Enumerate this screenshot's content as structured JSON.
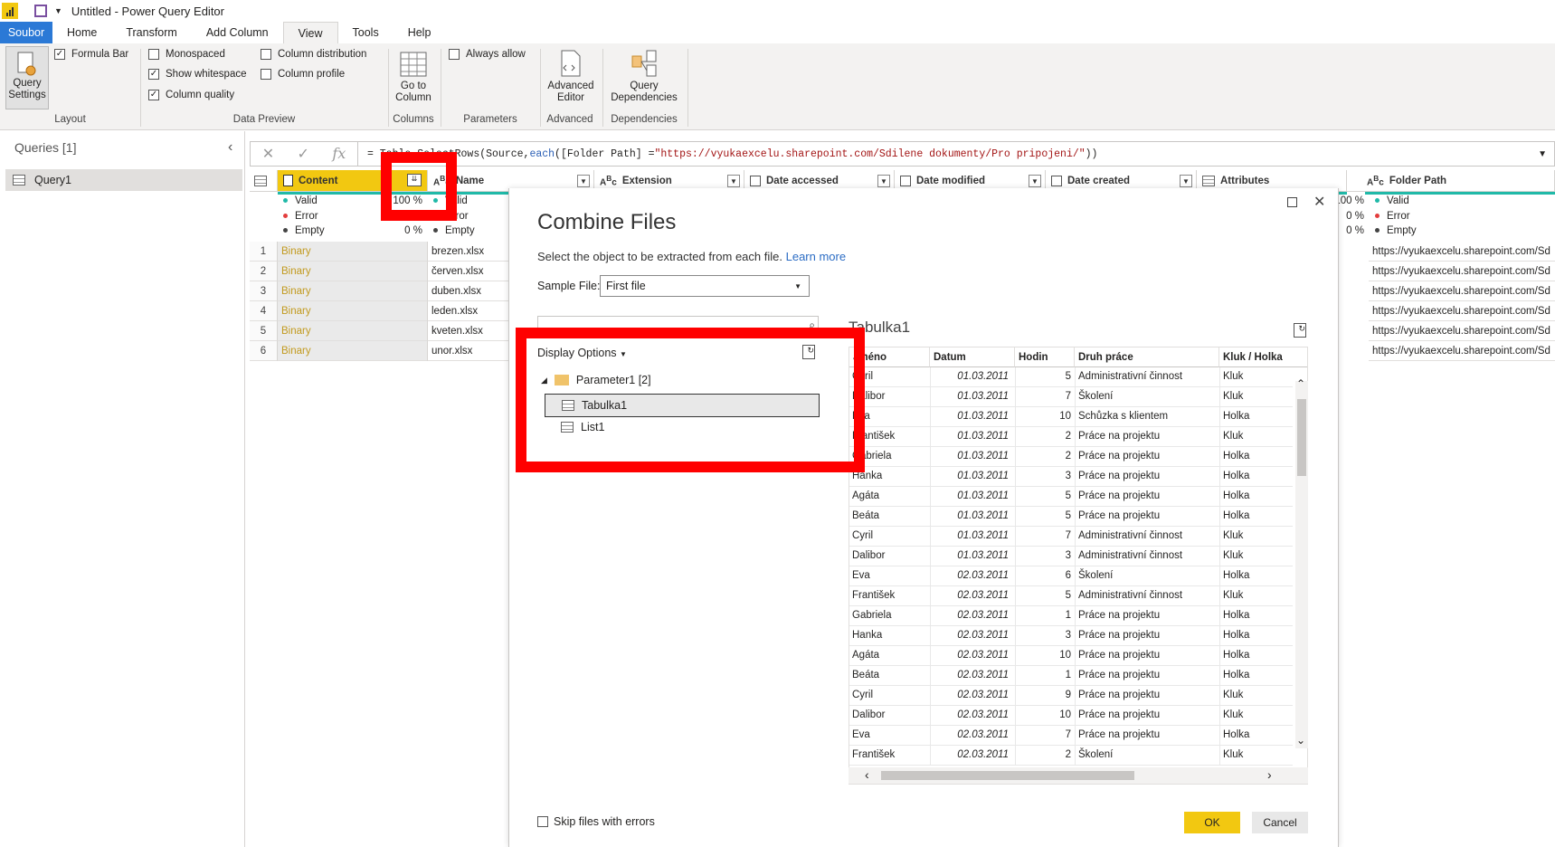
{
  "window": {
    "title": "Untitled - Power Query Editor"
  },
  "tabs": [
    "Soubor",
    "Home",
    "Transform",
    "Add Column",
    "View",
    "Tools",
    "Help"
  ],
  "ribbon": {
    "layout": {
      "query_settings": "Query Settings",
      "formula_bar": "Formula Bar",
      "label": "Layout"
    },
    "data_preview": {
      "monospaced": "Monospaced",
      "show_whitespace": "Show whitespace",
      "column_quality": "Column quality",
      "column_distribution": "Column distribution",
      "column_profile": "Column profile",
      "label": "Data Preview"
    },
    "columns": {
      "go_to_column": "Go to Column",
      "label": "Columns"
    },
    "parameters": {
      "always_allow": "Always allow",
      "label": "Parameters"
    },
    "advanced": {
      "advanced_editor": "Advanced Editor",
      "label": "Advanced"
    },
    "dependencies": {
      "query_dependencies": "Query Dependencies",
      "label": "Dependencies"
    }
  },
  "queries": {
    "header": "Queries [1]",
    "items": [
      "Query1"
    ]
  },
  "formula": {
    "prefix": "= Table.SelectRows(Source, ",
    "kw": "each",
    "mid": " ([Folder Path] = ",
    "str": "\"https://vyukaexcelu.sharepoint.com/Sdilene dokumenty/Pro pripojeni/\"",
    "suffix": "))"
  },
  "grid": {
    "columns": [
      "Content",
      "Name",
      "Extension",
      "Date accessed",
      "Date modified",
      "Date created",
      "Attributes",
      "Folder Path"
    ],
    "quality": {
      "valid": "Valid",
      "error": "Error",
      "empty": "Empty",
      "content_valid": "100 %",
      "content_error": "0 %",
      "content_empty": "0 %",
      "fp_valid": "100 %",
      "fp_error": "0 %",
      "fp_empty": "0 %"
    },
    "rows": [
      {
        "n": "1",
        "content": "Binary",
        "name": "brezen.xlsx",
        "path": "https://vyukaexcelu.sharepoint.com/Sd"
      },
      {
        "n": "2",
        "content": "Binary",
        "name": "červen.xlsx",
        "path": "https://vyukaexcelu.sharepoint.com/Sd"
      },
      {
        "n": "3",
        "content": "Binary",
        "name": "duben.xlsx",
        "path": "https://vyukaexcelu.sharepoint.com/Sd"
      },
      {
        "n": "4",
        "content": "Binary",
        "name": "leden.xlsx",
        "path": "https://vyukaexcelu.sharepoint.com/Sd"
      },
      {
        "n": "5",
        "content": "Binary",
        "name": "kveten.xlsx",
        "path": "https://vyukaexcelu.sharepoint.com/Sd"
      },
      {
        "n": "6",
        "content": "Binary",
        "name": "unor.xlsx",
        "path": "https://vyukaexcelu.sharepoint.com/Sd"
      }
    ]
  },
  "dialog": {
    "title": "Combine Files",
    "subtitle": "Select the object to be extracted from each file.",
    "learn_more": "Learn more",
    "sample_file_label": "Sample File:",
    "sample_file_value": "First file",
    "display_options": "Display Options",
    "tree_parent": "Parameter1 [2]",
    "tree_items": [
      "Tabulka1",
      "List1"
    ],
    "preview_title": "Tabulka1",
    "preview_columns": [
      "Jméno",
      "Datum",
      "Hodin",
      "Druh práce",
      "Kluk / Holka"
    ],
    "preview_rows": [
      [
        "Cyril",
        "01.03.2011",
        "5",
        "Administrativní činnost",
        "Kluk"
      ],
      [
        "Dalibor",
        "01.03.2011",
        "7",
        "Školení",
        "Kluk"
      ],
      [
        "Eva",
        "01.03.2011",
        "10",
        "Schůzka s klientem",
        "Holka"
      ],
      [
        "František",
        "01.03.2011",
        "2",
        "Práce na projektu",
        "Kluk"
      ],
      [
        "Gabriela",
        "01.03.2011",
        "2",
        "Práce na projektu",
        "Holka"
      ],
      [
        "Hanka",
        "01.03.2011",
        "3",
        "Práce na projektu",
        "Holka"
      ],
      [
        "Agáta",
        "01.03.2011",
        "5",
        "Práce na projektu",
        "Holka"
      ],
      [
        "Beáta",
        "01.03.2011",
        "5",
        "Práce na projektu",
        "Holka"
      ],
      [
        "Cyril",
        "01.03.2011",
        "7",
        "Administrativní činnost",
        "Kluk"
      ],
      [
        "Dalibor",
        "01.03.2011",
        "3",
        "Administrativní činnost",
        "Kluk"
      ],
      [
        "Eva",
        "02.03.2011",
        "6",
        "Školení",
        "Holka"
      ],
      [
        "František",
        "02.03.2011",
        "5",
        "Administrativní činnost",
        "Kluk"
      ],
      [
        "Gabriela",
        "02.03.2011",
        "1",
        "Práce na projektu",
        "Holka"
      ],
      [
        "Hanka",
        "02.03.2011",
        "3",
        "Práce na projektu",
        "Holka"
      ],
      [
        "Agáta",
        "02.03.2011",
        "10",
        "Práce na projektu",
        "Holka"
      ],
      [
        "Beáta",
        "02.03.2011",
        "1",
        "Práce na projektu",
        "Holka"
      ],
      [
        "Cyril",
        "02.03.2011",
        "9",
        "Práce na projektu",
        "Kluk"
      ],
      [
        "Dalibor",
        "02.03.2011",
        "10",
        "Práce na projektu",
        "Kluk"
      ],
      [
        "Eva",
        "02.03.2011",
        "7",
        "Práce na projektu",
        "Holka"
      ],
      [
        "František",
        "02.03.2011",
        "2",
        "Školení",
        "Kluk"
      ]
    ],
    "skip_errors": "Skip files with errors",
    "ok": "OK",
    "cancel": "Cancel"
  },
  "colors": {
    "accent_yellow": "#f2c811",
    "file_tab": "#2b79d6",
    "highlight_red": "#ff0000",
    "binary_text": "#c29a1e"
  }
}
